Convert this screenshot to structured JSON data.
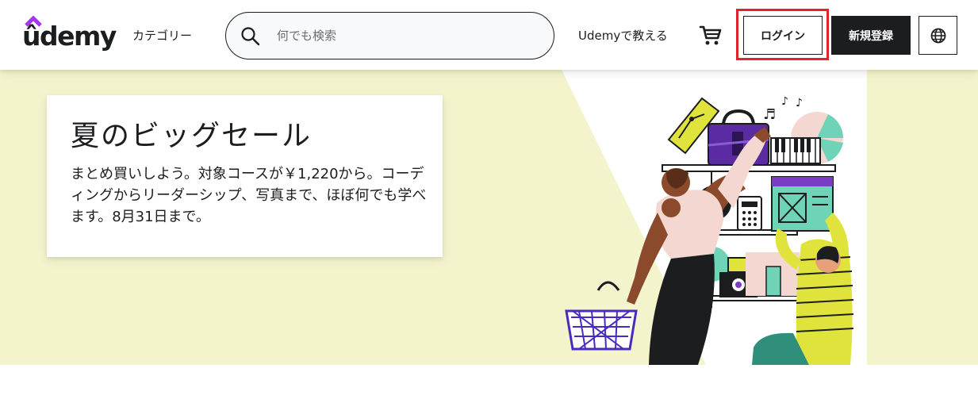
{
  "header": {
    "logo_text": "ûdemy",
    "categories_label": "カテゴリー",
    "search": {
      "placeholder": "何でも検索",
      "value": ""
    },
    "teach_label": "Udemyで教える",
    "login_label": "ログイン",
    "signup_label": "新規登録",
    "icons": [
      "search-icon",
      "cart-icon",
      "globe-icon"
    ]
  },
  "banner": {
    "title": "夏のビッグセール",
    "body": "まとめ買いしよう。対象コースが￥1,220から。コーディングからリーダーシップ、写真まで、ほぼ何でも学べます。8月31日まで。"
  },
  "colors": {
    "brand_dark": "#1c1d1f",
    "brand_purple": "#a435f0",
    "banner_bg": "#f3f3cc",
    "highlight_red": "#e2222c"
  }
}
